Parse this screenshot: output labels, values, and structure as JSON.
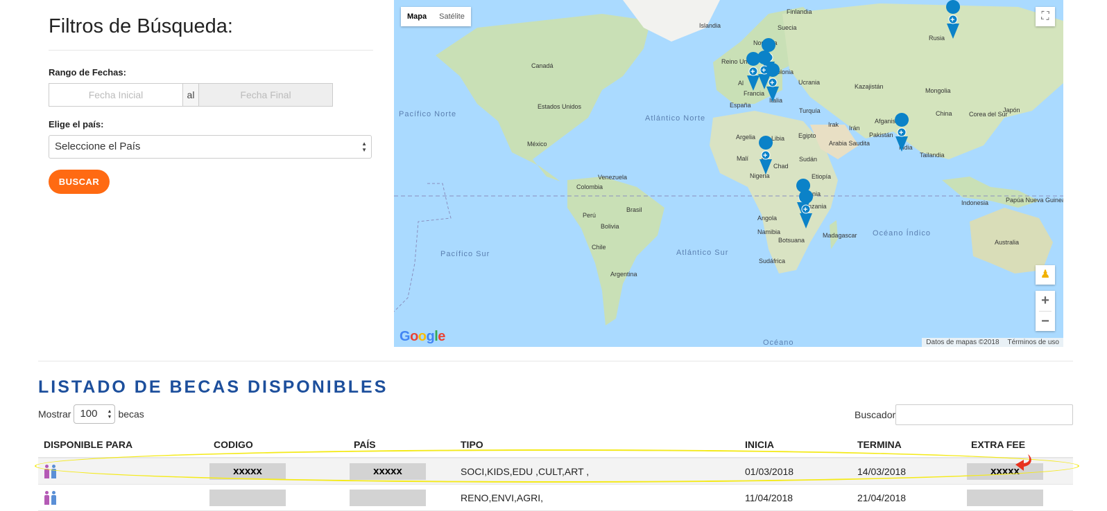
{
  "filters": {
    "title": "Filtros de Búsqueda:",
    "date_range_label": "Rango de Fechas:",
    "start_placeholder": "Fecha Inicial",
    "date_separator": "al",
    "end_placeholder": "Fecha Final",
    "country_label": "Elige el país:",
    "country_selected": "Seleccione el País",
    "search_button": "BUSCAR"
  },
  "map": {
    "type_map": "Mapa",
    "type_satellite": "Satélite",
    "zoom_in": "+",
    "zoom_out": "−",
    "logo": "Google",
    "attribution_data": "Datos de mapas ©2018",
    "attribution_terms": "Términos de uso",
    "labels": {
      "finlandia": "Finlandia",
      "islandia": "Islandia",
      "suecia": "Suecia",
      "noruega": "Noruega",
      "rusia": "Rusia",
      "canada": "Canadá",
      "reino_unido": "Reino Unido",
      "polonia": "Polonia",
      "ucrania": "Ucrania",
      "kazajistan": "Kazajistán",
      "mongolia": "Mongolia",
      "alemania": "Al",
      "francia": "Francia",
      "italia": "Italia",
      "espana": "España",
      "estados_unidos": "Estados Unidos",
      "pacifico_norte": "Pacífico Norte",
      "atlantico_norte": "Atlántico Norte",
      "turquia": "Turquía",
      "irak": "Irak",
      "iran": "Irán",
      "afganistan": "Afganistán",
      "china": "China",
      "corea_del_sur": "Corea del Sur",
      "japon": "Japón",
      "pakistan": "Pakistán",
      "india": "India",
      "mexico": "México",
      "argelia": "Argelia",
      "libia": "Libia",
      "egipto": "Egipto",
      "arabia_saudita": "Arabia Saudita",
      "tailandia": "Tailandia",
      "mali": "Malí",
      "chad": "Chad",
      "sudan": "Sudán",
      "niger": "er",
      "nigeria": "Nigeria",
      "etiopia": "Etiopía",
      "venezuela": "Venezuela",
      "colombia": "Colombia",
      "kenia": "Kenia",
      "tanzania": "anzania",
      "papua": "Papúa Nueva Guinea",
      "indonesia": "Indonesia",
      "brasil": "Brasil",
      "peru": "Perú",
      "bolivia": "Bolivia",
      "angola": "Angola",
      "namibia": "Namibia",
      "botsuana": "Botsuana",
      "madagascar": "Madagascar",
      "oceano_indico": "Océano Índico",
      "pacifico_sur": "Pacífico Sur",
      "atlantico_sur": "Atlántico Sur",
      "chile": "Chile",
      "sudafrica": "Sudáfrica",
      "australia": "Australia",
      "argentina": "Argentina",
      "oceano_bottom": "Océano"
    }
  },
  "listing": {
    "title": "LISTADO DE BECAS DISPONIBLES",
    "show_label": "Mostrar",
    "show_value": "100",
    "show_suffix": "becas",
    "search_label": "Buscador",
    "columns": [
      "DISPONIBLE PARA",
      "CODIGO",
      "PAÍS",
      "TIPO",
      "INICIA",
      "TERMINA",
      "EXTRA FEE"
    ],
    "rows": [
      {
        "codigo": "xxxxx",
        "pais": "xxxxx",
        "tipo": "SOCI,KIDS,EDU ,CULT,ART ,",
        "inicia": "01/03/2018",
        "termina": "14/03/2018",
        "extra_fee": "xxxxx"
      },
      {
        "codigo": "",
        "pais": "",
        "tipo": "RENO,ENVI,AGRI,",
        "inicia": "11/04/2018",
        "termina": "21/04/2018",
        "extra_fee": ""
      }
    ]
  },
  "colors": {
    "accent": "#ff6a12",
    "title_blue": "#1d4f9c",
    "marker": "#0b82c8",
    "highlight": "#f4ea1b",
    "water": "#aadaff",
    "land": "#c9e0b6"
  }
}
